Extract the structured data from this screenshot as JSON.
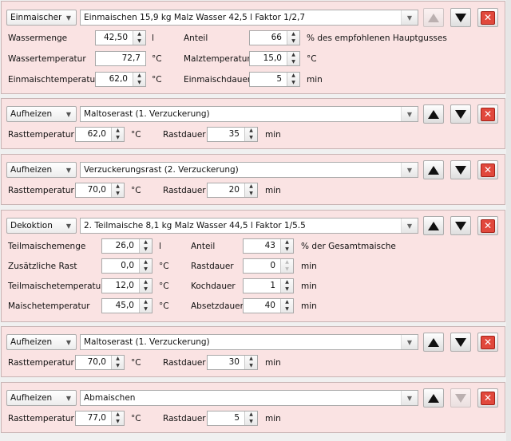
{
  "steps": [
    {
      "type": "Einmaischen",
      "title": "Einmaischen 15,9 kg Malz  Wasser 42,5 l Faktor 1/2,7",
      "up_enabled": false,
      "down_enabled": true,
      "rows": [
        {
          "l1": "Wassermenge",
          "v1": "42,50",
          "u1": "l",
          "l2": "Anteil",
          "v2": "66",
          "u2": "% des empfohlenen Hauptgusses"
        },
        {
          "l1": "Wassertemperatur",
          "v1": "72,7",
          "u1": "°C",
          "l2": "Malztemperatur",
          "v2": "15,0",
          "u2": "°C"
        },
        {
          "l1": "Einmaischtemperatur",
          "v1": "62,0",
          "u1": "°C",
          "l2": "Einmaischdauer",
          "v2": "5",
          "u2": "min"
        }
      ]
    },
    {
      "type": "Aufheizen",
      "title": "Maltoserast (1. Verzuckerung)",
      "up_enabled": true,
      "down_enabled": true,
      "rows": [
        {
          "l1": "Rasttemperatur",
          "v1": "62,0",
          "u1": "°C",
          "l2": "Rastdauer",
          "v2": "35",
          "u2": "min"
        }
      ]
    },
    {
      "type": "Aufheizen",
      "title": "Verzuckerungsrast (2. Verzuckerung)",
      "up_enabled": true,
      "down_enabled": true,
      "rows": [
        {
          "l1": "Rasttemperatur",
          "v1": "70,0",
          "u1": "°C",
          "l2": "Rastdauer",
          "v2": "20",
          "u2": "min"
        }
      ]
    },
    {
      "type": "Dekoktion",
      "title": "2. Teilmaische 8,1 kg Malz Wasser 44,5 l Faktor 1/5.5",
      "up_enabled": true,
      "down_enabled": true,
      "rows": [
        {
          "l1": "Teilmaischemenge",
          "v1": "26,0",
          "u1": "l",
          "l2": "Anteil",
          "v2": "43",
          "u2": "% der Gesamtmaische"
        },
        {
          "l1": "Zusätzliche Rast",
          "v1": "0,0",
          "u1": "°C",
          "l2": "Rastdauer",
          "v2": "0",
          "u2": "min"
        },
        {
          "l1": "Teilmaischetemperatur",
          "v1": "12,0",
          "u1": "°C",
          "l2": "Kochdauer",
          "v2": "1",
          "u2": "min"
        },
        {
          "l1": "Maischetemperatur",
          "v1": "45,0",
          "u1": "°C",
          "l2": "Absetzdauer",
          "v2": "40",
          "u2": "min"
        }
      ]
    },
    {
      "type": "Aufheizen",
      "title": "Maltoserast (1. Verzuckerung)",
      "up_enabled": true,
      "down_enabled": true,
      "rows": [
        {
          "l1": "Rasttemperatur",
          "v1": "70,0",
          "u1": "°C",
          "l2": "Rastdauer",
          "v2": "30",
          "u2": "min"
        }
      ]
    },
    {
      "type": "Aufheizen",
      "title": "Abmaischen",
      "up_enabled": true,
      "down_enabled": false,
      "rows": [
        {
          "l1": "Rasttemperatur",
          "v1": "77,0",
          "u1": "°C",
          "l2": "Rastdauer",
          "v2": "5",
          "u2": "min"
        }
      ]
    }
  ],
  "icons": {
    "combo_arrow": "chevron-down-icon",
    "delete": "close-icon",
    "up": "triangle-up-icon",
    "down": "triangle-down-icon"
  },
  "colors": {
    "panel_bg": "#fae3e3",
    "delete_button": "#e1483c"
  }
}
